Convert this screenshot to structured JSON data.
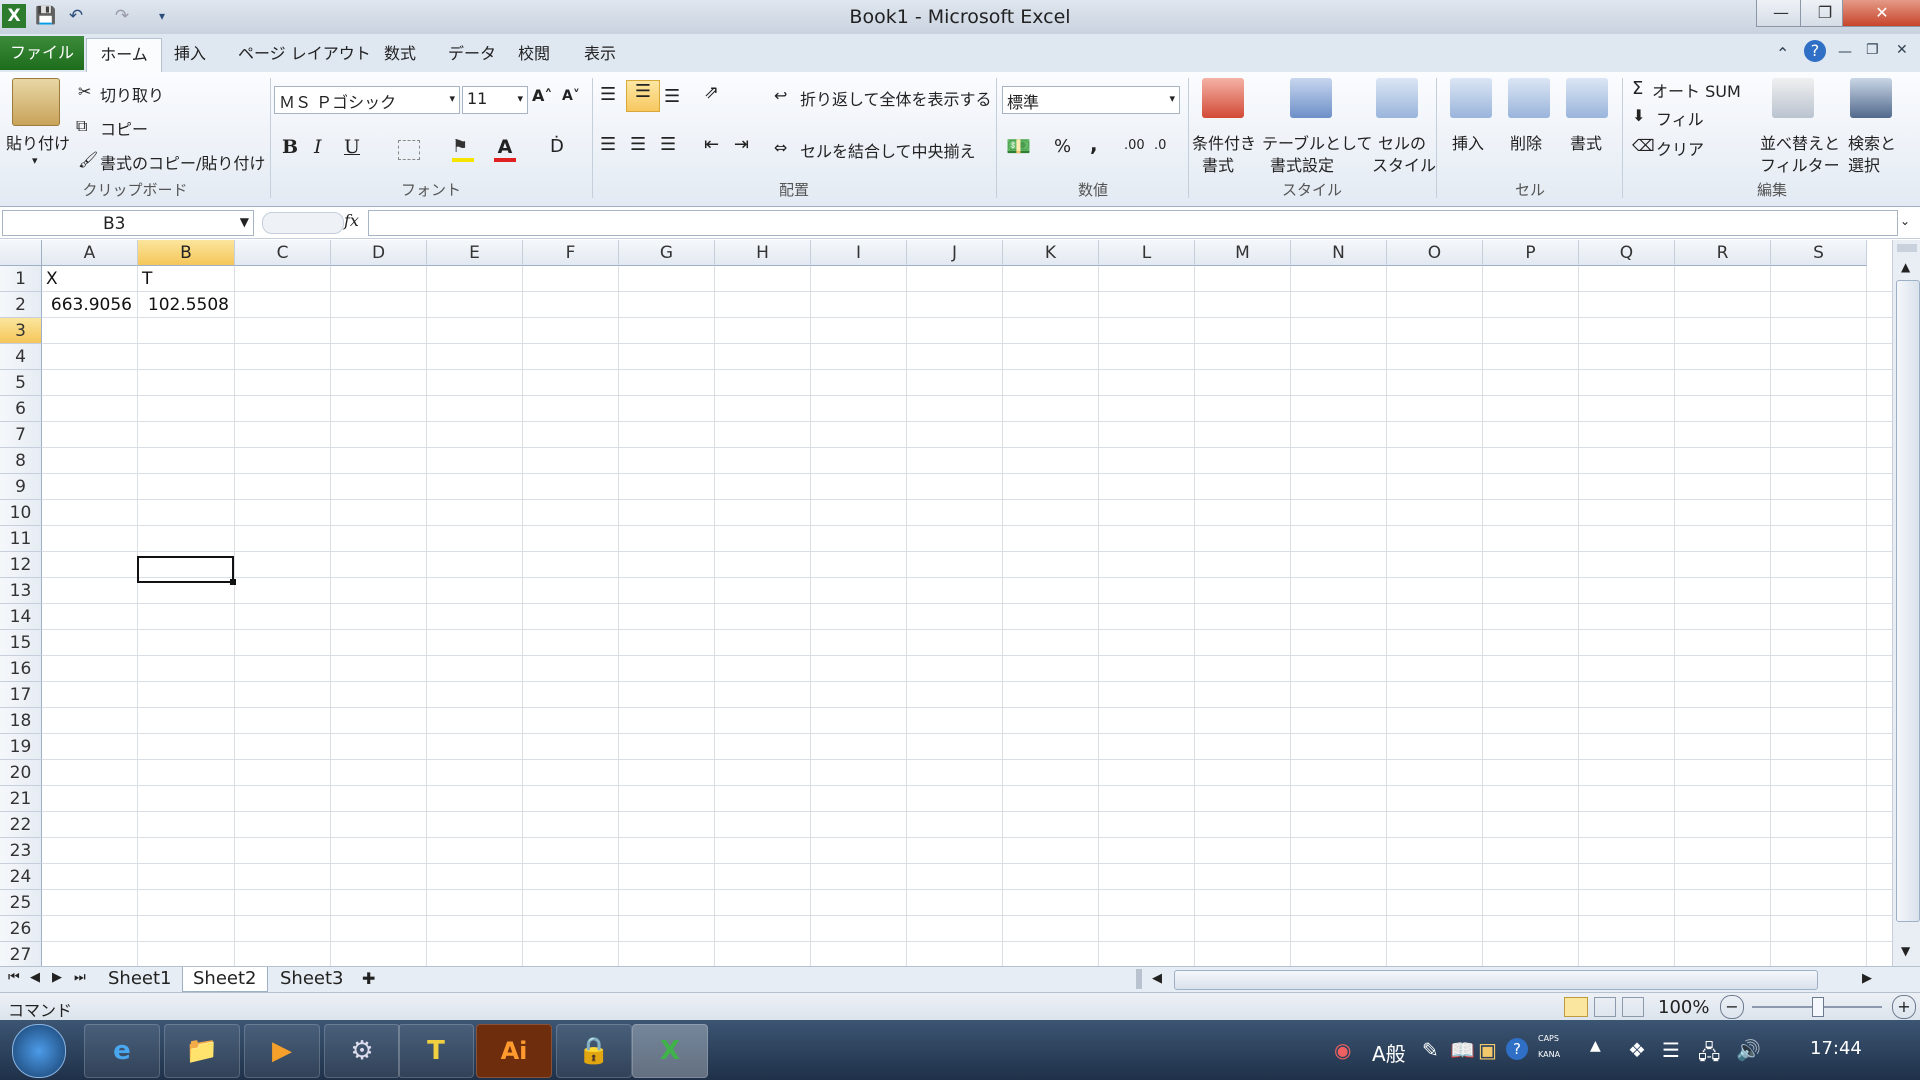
{
  "window": {
    "title": "Book1 - Microsoft Excel"
  },
  "tabs": [
    "ファイル",
    "ホーム",
    "挿入",
    "ページ レイアウト",
    "数式",
    "データ",
    "校閲",
    "表示"
  ],
  "ribbon": {
    "clipboard": {
      "paste": "貼り付け",
      "cut": "切り取り",
      "copy": "コピー",
      "format_painter": "書式のコピー/貼り付け",
      "label": "クリップボード"
    },
    "font": {
      "name": "ＭＳ Ｐゴシック",
      "size": "11",
      "bold": "B",
      "italic": "I",
      "underline": "U",
      "label": "フォント"
    },
    "alignment": {
      "wrap": "折り返して全体を表示する",
      "merge": "セルを結合して中央揃え",
      "label": "配置"
    },
    "number": {
      "format": "標準",
      "percent": "%",
      "comma": ",",
      "label": "数値"
    },
    "styles": {
      "conditional": [
        "条件付き",
        "書式"
      ],
      "table": [
        "テーブルとして",
        "書式設定"
      ],
      "cell": [
        "セルの",
        "スタイル"
      ],
      "label": "スタイル"
    },
    "cells": {
      "insert": "挿入",
      "delete": "削除",
      "format": "書式",
      "label": "セル"
    },
    "editing": {
      "autosum": "オート SUM",
      "fill": "フィル",
      "clear": "クリア",
      "sort": [
        "並べ替えと",
        "フィルター"
      ],
      "find": [
        "検索と",
        "選択"
      ],
      "label": "編集"
    }
  },
  "formula_bar": {
    "name_box": "B3",
    "fx": "fx",
    "formula": ""
  },
  "columns": [
    "A",
    "B",
    "C",
    "D",
    "E",
    "F",
    "G",
    "H",
    "I",
    "J",
    "K",
    "L",
    "M",
    "N",
    "O",
    "P",
    "Q",
    "R",
    "S"
  ],
  "rows": [
    "1",
    "2",
    "3",
    "4",
    "5",
    "6",
    "7",
    "8",
    "9",
    "10",
    "11",
    "12",
    "13",
    "14",
    "15",
    "16",
    "17",
    "18",
    "19",
    "20",
    "21",
    "22",
    "23",
    "24",
    "25",
    "26",
    "27"
  ],
  "cells": {
    "A1": "X",
    "B1": "T",
    "A2": "663.9056",
    "B2": "102.5508"
  },
  "sheets": [
    "Sheet1",
    "Sheet2",
    "Sheet3"
  ],
  "status": {
    "mode": "コマンド",
    "zoom": "100%"
  },
  "taskbar": {
    "ime": "A般",
    "clock": "17:44",
    "caps": "CAPS",
    "kana": "KANA"
  }
}
